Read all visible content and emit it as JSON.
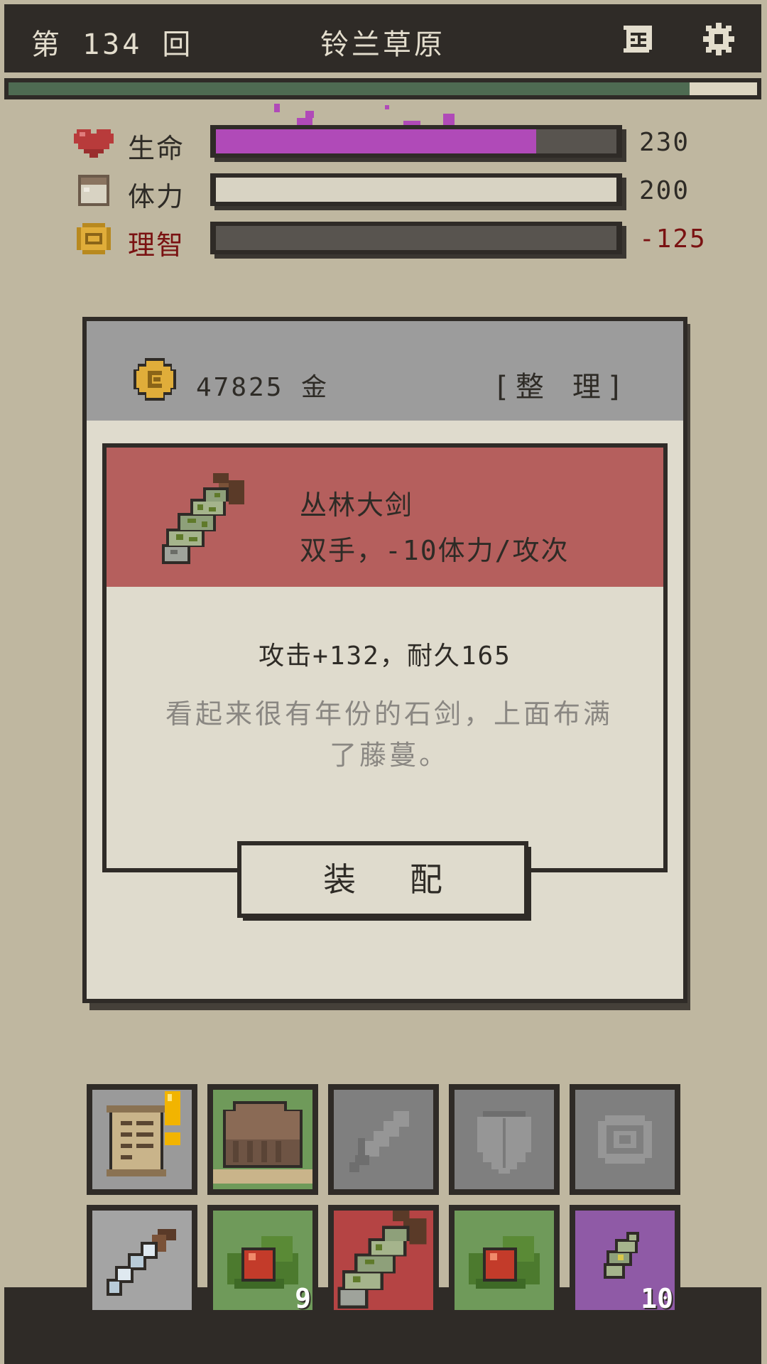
{
  "header": {
    "round_label": "第 134 回",
    "location": "铃兰草原",
    "map_icon": "scroll-map-icon",
    "settings_icon": "gear-icon"
  },
  "progress": {
    "value": 0.91,
    "fill_color": "#4e6b52"
  },
  "stats": [
    {
      "key": "life",
      "label": "生命",
      "value": "230",
      "fill": 0.8,
      "fill_color": "#b04ab8",
      "icon": "heart-icon"
    },
    {
      "key": "stamina",
      "label": "体力",
      "value": "200",
      "fill": 1.0,
      "fill_color": "#d8d3c3",
      "icon": "stamina-icon"
    },
    {
      "key": "sanity",
      "label": "理智",
      "value": "-125",
      "fill": 0.0,
      "fill_color": "#58544f",
      "icon": "sanity-coin-icon",
      "highlight": "#7a1212"
    }
  ],
  "panel": {
    "gold_amount": "47825 金",
    "sort_label": "[整 理]",
    "item": {
      "icon": "jungle-greatsword-icon",
      "name": "丛林大剑",
      "type": "双手，-10体力/攻次",
      "stats": "攻击+132，耐久165",
      "description": "看起来很有年份的石剑，上面布满了藤蔓。"
    },
    "equip_label": "装 配"
  },
  "inventory": {
    "row1": [
      {
        "icon": "quest-scroll-icon",
        "bg": "#9a9a9a",
        "alert": true
      },
      {
        "icon": "backpack-icon",
        "bg": "#6f9a5a"
      },
      {
        "icon": "sword-slot-icon",
        "bg": "#7f7f7f"
      },
      {
        "icon": "shield-slot-icon",
        "bg": "#7f7f7f"
      },
      {
        "icon": "accessory-slot-icon",
        "bg": "#7f7f7f"
      }
    ],
    "row2": [
      {
        "icon": "steel-sword-icon",
        "bg": "#a4a4a4",
        "count": ""
      },
      {
        "icon": "berry-icon",
        "bg": "#6f9a5a",
        "count": "9"
      },
      {
        "icon": "jungle-greatsword-icon",
        "bg": "#b54444",
        "count": ""
      },
      {
        "icon": "berry-icon",
        "bg": "#6f9a5a",
        "count": ""
      },
      {
        "icon": "herb-leaf-icon",
        "bg": "#8f5aa6",
        "count": "10"
      }
    ]
  }
}
